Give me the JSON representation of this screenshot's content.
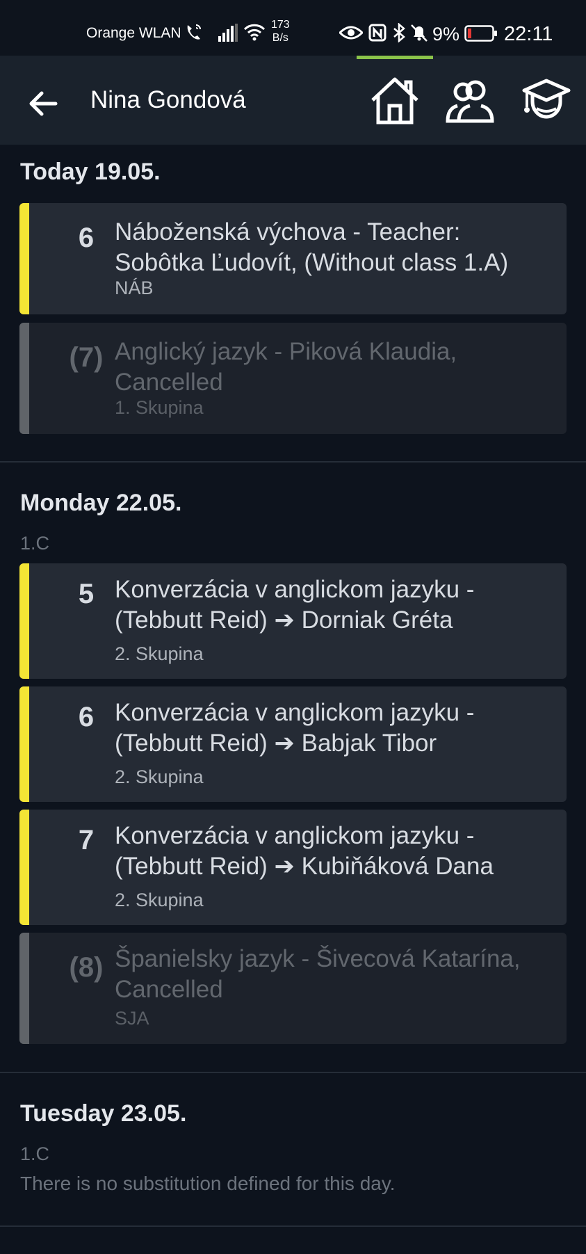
{
  "status_bar": {
    "carrier": "Orange WLAN",
    "speed_value": "173",
    "speed_unit": "B/s",
    "battery_percent": "9%",
    "time": "22:11"
  },
  "app_bar": {
    "title": "Nina Gondová",
    "icons": [
      "back-arrow-icon",
      "home-icon",
      "people-icon",
      "graduate-icon"
    ]
  },
  "days": [
    {
      "title": "Today 19.05.",
      "lessons": [
        {
          "period": "6",
          "lines": [
            "Náboženská výchova - Teacher:",
            "Sobôtka Ľudovít, (Without class 1.A)"
          ],
          "sub": "NÁB",
          "cancelled": false
        },
        {
          "period": "(7)",
          "lines": [
            "Anglický jazyk - Piková Klaudia,",
            "Cancelled"
          ],
          "sub": "1. Skupina",
          "cancelled": true
        }
      ]
    },
    {
      "title": "Monday 22.05.",
      "class": "1.C",
      "lessons": [
        {
          "period": "5",
          "lines": [
            "Konverzácia v anglickom jazyku -",
            "(Tebbutt Reid) ➔ Dorniak Gréta"
          ],
          "sub": "2. Skupina",
          "cancelled": false
        },
        {
          "period": "6",
          "lines": [
            "Konverzácia v anglickom jazyku -",
            "(Tebbutt Reid) ➔ Babjak Tibor"
          ],
          "sub": "2. Skupina",
          "cancelled": false
        },
        {
          "period": "7",
          "lines": [
            "Konverzácia v anglickom jazyku -",
            "(Tebbutt Reid) ➔ Kubiňáková Dana"
          ],
          "sub": "2. Skupina",
          "cancelled": false
        },
        {
          "period": "(8)",
          "lines": [
            "Španielsky jazyk - Šivecová Katarína,",
            "Cancelled"
          ],
          "sub": "SJA",
          "cancelled": true
        }
      ]
    },
    {
      "title": "Tuesday 23.05.",
      "class": "1.C",
      "empty_note": "There is no substitution defined for this day."
    }
  ],
  "colors": {
    "background": "#0d131d",
    "appbar": "#1a222c",
    "card": "#252b35",
    "accent_bar": "#f4e535",
    "cancelled_bar": "#606469",
    "indicator": "#8bc34a"
  }
}
